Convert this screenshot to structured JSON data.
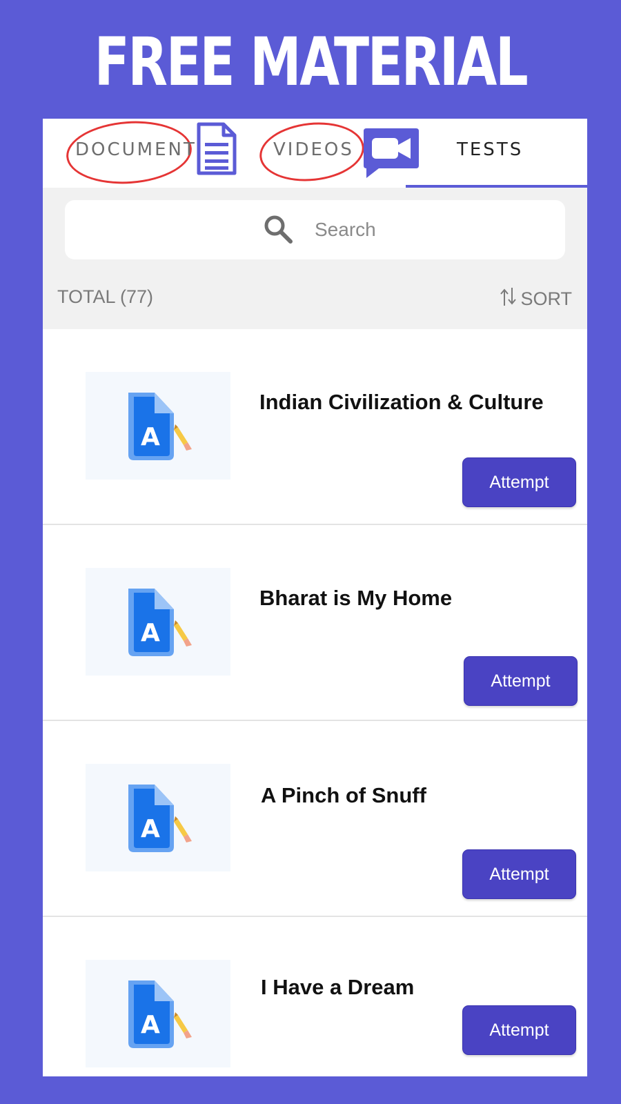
{
  "banner": {
    "title": "FREE MATERIAL"
  },
  "tabs": [
    {
      "label": "DOCUMENT",
      "icon": "document-icon",
      "circled": true
    },
    {
      "label": "VIDEOS",
      "icon": "video-chat-icon",
      "circled": true
    },
    {
      "label": "TESTS",
      "active": true
    }
  ],
  "search": {
    "placeholder": "Search",
    "value": ""
  },
  "list_header": {
    "total": "TOTAL (77)",
    "sort": "SORT"
  },
  "items": [
    {
      "title": "Indian Civilization & Culture",
      "action": "Attempt",
      "icon": "test-document-icon"
    },
    {
      "title": "Bharat is My Home",
      "action": "Attempt",
      "icon": "test-document-icon"
    },
    {
      "title": "A Pinch of Snuff",
      "action": "Attempt",
      "icon": "test-document-icon"
    },
    {
      "title": "I Have a Dream",
      "action": "Attempt",
      "icon": "test-document-icon"
    }
  ],
  "colors": {
    "background": "#5b5bd6",
    "accent": "#4a43c3",
    "annotation": "#e53535",
    "icon_blue": "#1a73e8"
  }
}
